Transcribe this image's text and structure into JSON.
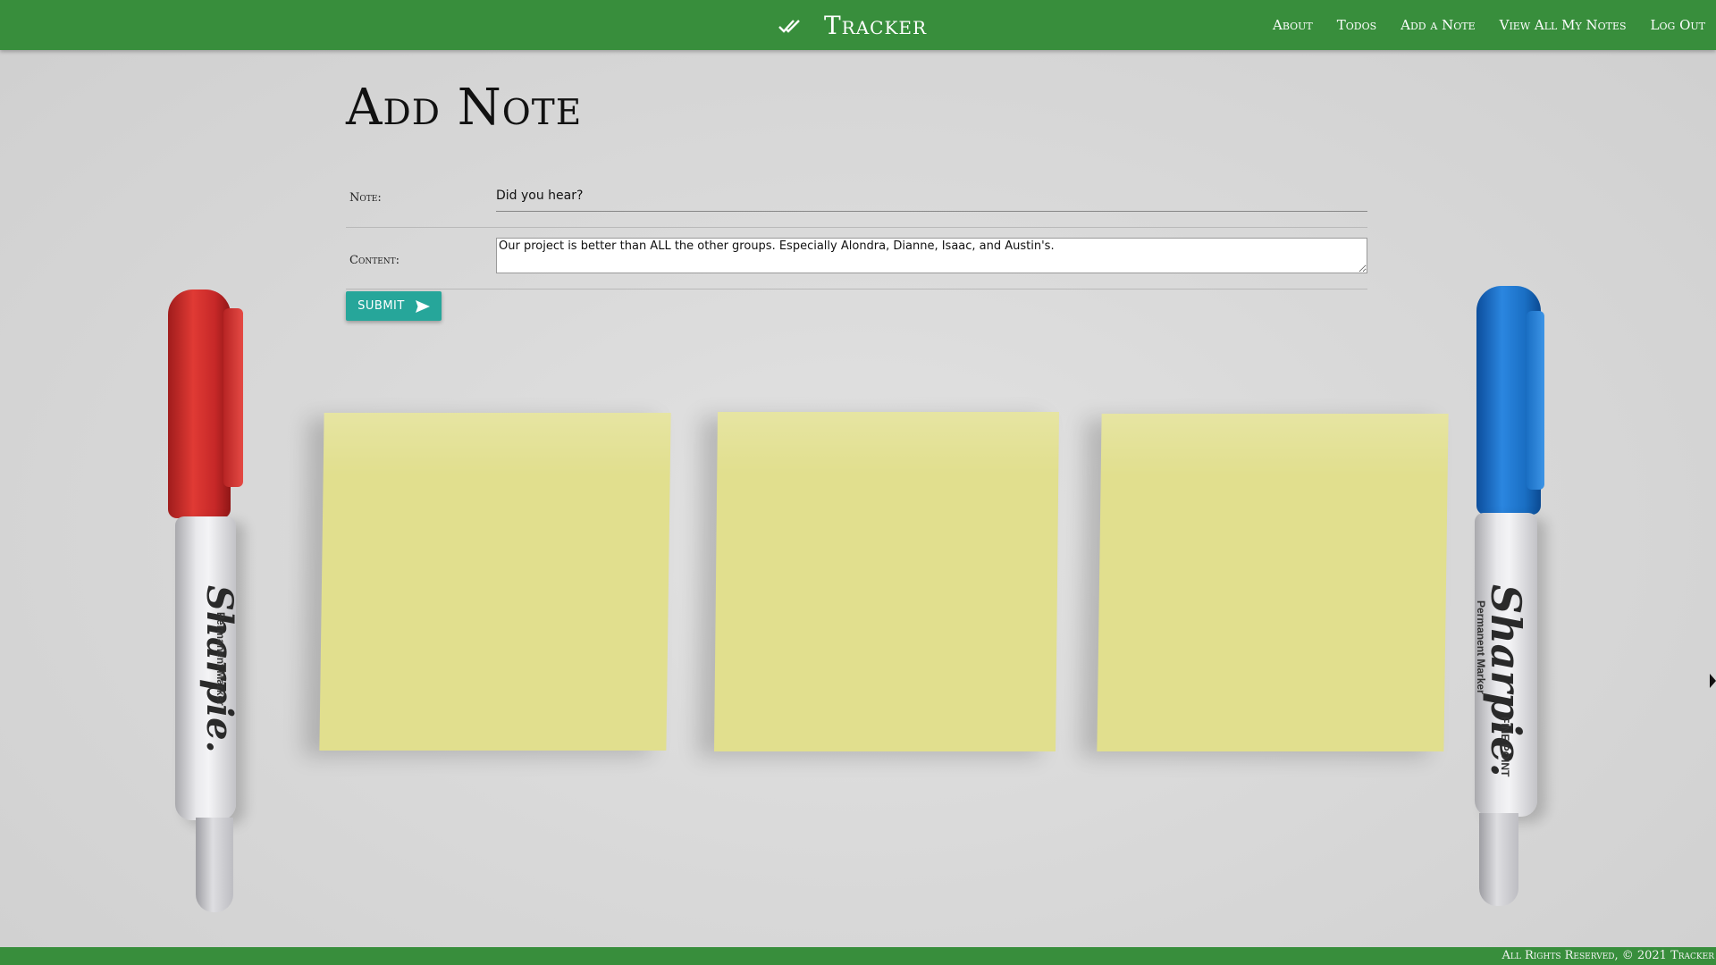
{
  "header": {
    "brand_title": "Tracker",
    "brand_icon": "double-check-icon",
    "nav": [
      "About",
      "Todos",
      "Add a Note",
      "View All My Notes",
      "Log Out"
    ],
    "color": "#388e3c"
  },
  "main": {
    "title": "Add Note",
    "note_label": "Note:",
    "note_value": "Did you hear?",
    "content_label": "Content:",
    "content_value": "Our project is better than ALL the other groups. Especially Alondra, Dianne, Isaac, and Austin's.",
    "submit_label": "SUBMIT",
    "submit_icon": "send-icon",
    "submit_color": "#26a69a"
  },
  "background": {
    "marker_brand": "Sharpie.",
    "marker_text_1": "Permanent Marker",
    "marker_text_2": "FINE POINT",
    "marker_left_color": "#d32f2f",
    "marker_right_color": "#1e6fc4",
    "sticky_note_color": "#e1df8e"
  },
  "footer": {
    "text": "All Rights Reserved, © 2021 Tracker"
  }
}
